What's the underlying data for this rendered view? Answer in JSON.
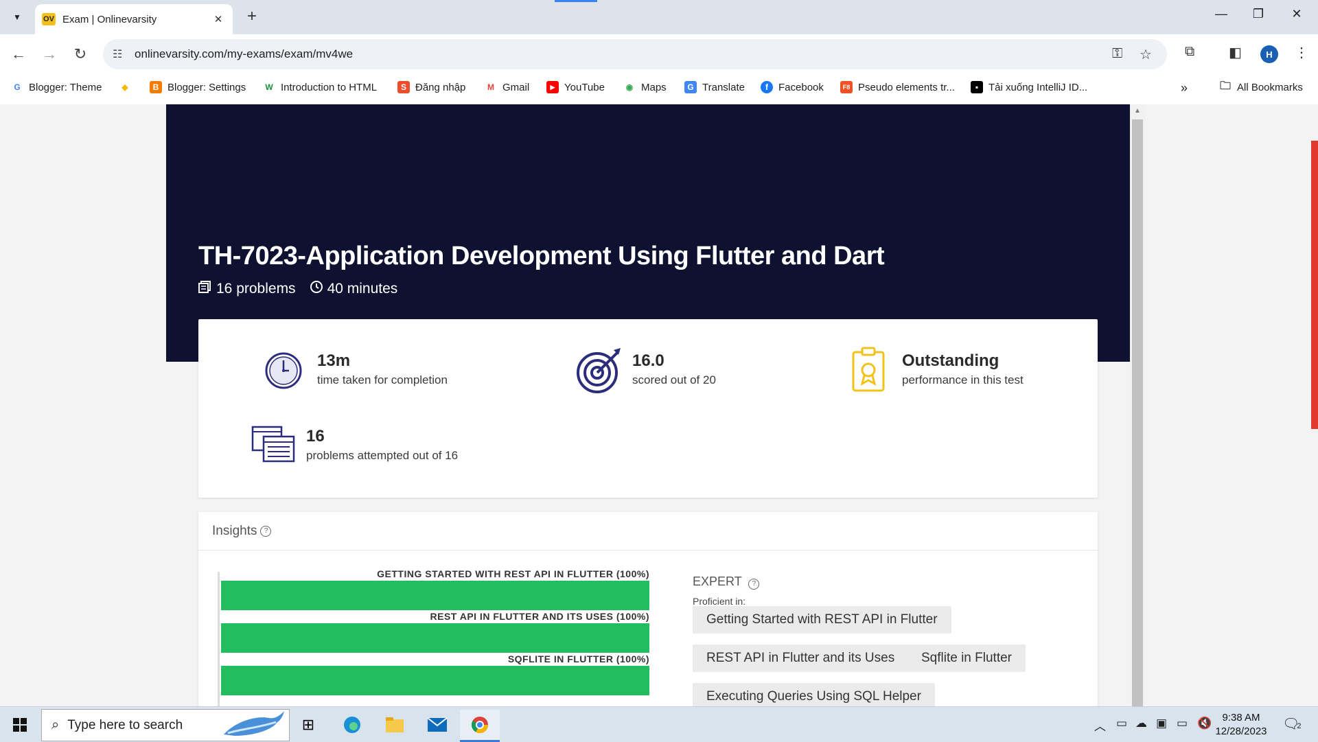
{
  "browser": {
    "tab_title": "Exam | Onlinevarsity",
    "tab_favicon": "OV",
    "url": "onlinevarsity.com/my-exams/exam/mv4we",
    "profile_initial": "H"
  },
  "bookmarks": [
    {
      "label": "Blogger: Theme",
      "icon": "G",
      "color": "#4285f4"
    },
    {
      "label": "",
      "icon": "◆",
      "color": "#f0b90b"
    },
    {
      "label": "Blogger: Settings",
      "icon": "B",
      "color": "#f57c00"
    },
    {
      "label": "Introduction to HTML",
      "icon": "W",
      "color": "#1a8f3c"
    },
    {
      "label": "Đăng nhập",
      "icon": "S",
      "color": "#ee4d2d"
    },
    {
      "label": "Gmail",
      "icon": "M",
      "color": "#ea4335"
    },
    {
      "label": "YouTube",
      "icon": "▶",
      "color": "#ff0000"
    },
    {
      "label": "Maps",
      "icon": "◉",
      "color": "#34a853"
    },
    {
      "label": "Translate",
      "icon": "G",
      "color": "#4285f4"
    },
    {
      "label": "Facebook",
      "icon": "f",
      "color": "#1877f2"
    },
    {
      "label": "Pseudo elements tr...",
      "icon": "F8",
      "color": "#f05123"
    },
    {
      "label": "Tải xuống IntelliJ ID...",
      "icon": "▪",
      "color": "#000000"
    }
  ],
  "bookmarks_all": "All Bookmarks",
  "exam": {
    "title": "TH-7023-Application Development Using Flutter and Dart",
    "problems": "16 problems",
    "duration": "40 minutes"
  },
  "stats": {
    "time_value": "13m",
    "time_label": "time taken for completion",
    "score_value": "16.0",
    "score_label": "scored out of 20",
    "performance_value": "Outstanding",
    "performance_label": "performance in this test",
    "attempted_value": "16",
    "attempted_label": "problems attempted out of 16"
  },
  "insights": {
    "title": "Insights",
    "level": "EXPERT",
    "proficient_label": "Proficient in:",
    "chips": [
      "Getting Started with REST API in Flutter",
      "REST API in Flutter and its Uses",
      "Sqflite in Flutter",
      "Executing Queries Using SQL Helper"
    ]
  },
  "chart_data": {
    "type": "bar",
    "orientation": "horizontal",
    "categories": [
      "GETTING STARTED WITH REST API IN FLUTTER",
      "REST API IN FLUTTER AND ITS USES",
      "SQFLITE IN FLUTTER"
    ],
    "values": [
      100,
      100,
      100
    ],
    "value_labels": [
      "GETTING STARTED WITH REST API IN FLUTTER (100%)",
      "REST API IN FLUTTER AND ITS USES (100%)",
      "SQFLITE IN FLUTTER (100%)"
    ],
    "xlim": [
      0,
      100
    ],
    "bar_color": "#21bd5f"
  },
  "taskbar": {
    "search_placeholder": "Type here to search",
    "time": "9:38 AM",
    "date": "12/28/2023",
    "notification_count": "2"
  },
  "colors": {
    "hero_bg": "#0e1230",
    "accent_bar": "#21bd5f",
    "icon_navy": "#2b2d7c",
    "icon_gold": "#f2c21b"
  }
}
